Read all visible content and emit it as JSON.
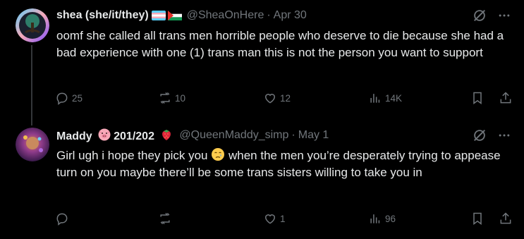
{
  "tweets": [
    {
      "display_name": "shea (she/it/they)",
      "handle": "@SheaOnHere",
      "separator": "·",
      "date": "Apr 30",
      "text": "oomf she called all trans men horrible people who deserve to die because she had a bad experience with one (1) trans man this is not the person you want to support",
      "replies": "25",
      "retweets": "10",
      "likes": "12",
      "views": "14K"
    },
    {
      "display_name": "Maddy",
      "name_suffix": "201/202",
      "handle": "@QueenMaddy_simp",
      "separator": "·",
      "date": "May 1",
      "text_before_emoji": "Girl ugh i hope they pick you",
      "text_after_emoji": "when the men you’re desperately trying to appease turn on you maybe there’ll be some trans sisters willing to take you in",
      "replies": "",
      "retweets": "",
      "likes": "1",
      "views": "96"
    }
  ],
  "icons": {
    "reply": "reply-icon",
    "retweet": "retweet-icon",
    "like": "heart-icon",
    "views": "views-icon",
    "bookmark": "bookmark-icon",
    "share": "share-icon",
    "grok": "grok-icon",
    "more": "more-icon"
  },
  "colors": {
    "background": "#000000",
    "text": "#e7e9ea",
    "muted": "#71767b",
    "thread_line": "#333639"
  }
}
